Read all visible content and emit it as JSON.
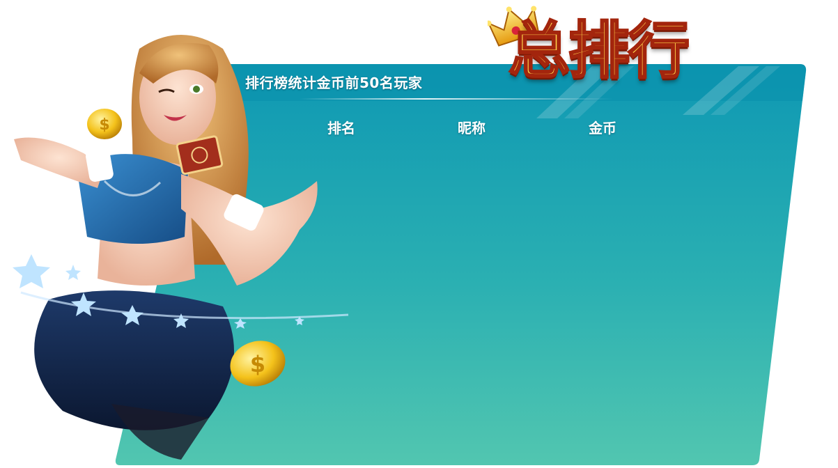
{
  "leaderboard": {
    "title": "总排行",
    "subtitle": "排行榜统计金币前50名玩家",
    "columns": {
      "rank": "排名",
      "nickname": "昵称",
      "coins": "金币"
    },
    "rows": []
  },
  "colors": {
    "panel_top": "#0e98b3",
    "panel_bottom": "#52c6b0",
    "title_fill": "#ffd34a",
    "title_stroke": "#a3250d"
  }
}
